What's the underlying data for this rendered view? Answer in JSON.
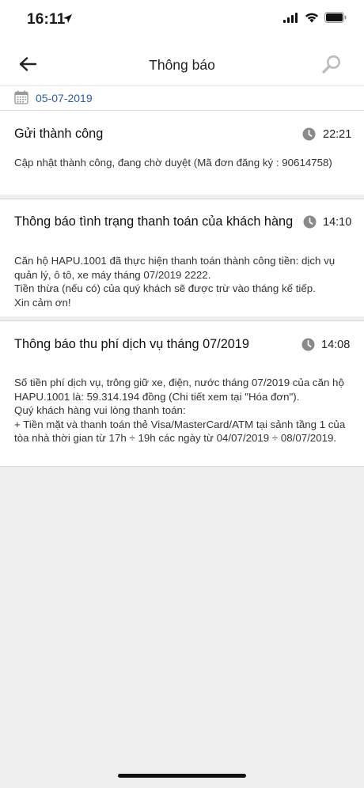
{
  "status_bar": {
    "time": "16:11"
  },
  "header": {
    "title": "Thông báo"
  },
  "date": "05-07-2019",
  "notifications": [
    {
      "title": "Gửi thành công",
      "time": "22:21",
      "body": "Cập nhật thành công, đang chờ duyệt (Mã đơn đăng ký : 90614758)"
    },
    {
      "title": "Thông báo tình trạng thanh toán của khách hàng",
      "time": "14:10",
      "body": "Căn hộ HAPU.1001 đã thực hiện thanh toán thành công tiền: dịch vụ quản lý, ô tô, xe máy tháng 07/2019 2222.\nTiền thừa (nếu có) của quý khách sẽ được trừ vào tháng kế tiếp.\nXin cảm ơn!"
    },
    {
      "title": "Thông báo thu phí dịch vụ tháng 07/2019",
      "time": "14:08",
      "body": "Số tiền phí dịch vụ, trông giữ xe, điện, nước tháng 07/2019 của căn hộ HAPU.1001 là: 59.314.194 đồng (Chi tiết xem tại \"Hóa đơn\").\nQuý khách hàng vui lòng thanh toán:\n+ Tiền mặt và thanh toán thẻ Visa/MasterCard/ATM tại sảnh tầng 1 của tòa nhà thời gian từ 17h ÷ 19h các ngày từ 04/07/2019 ÷ 08/07/2019."
    }
  ]
}
